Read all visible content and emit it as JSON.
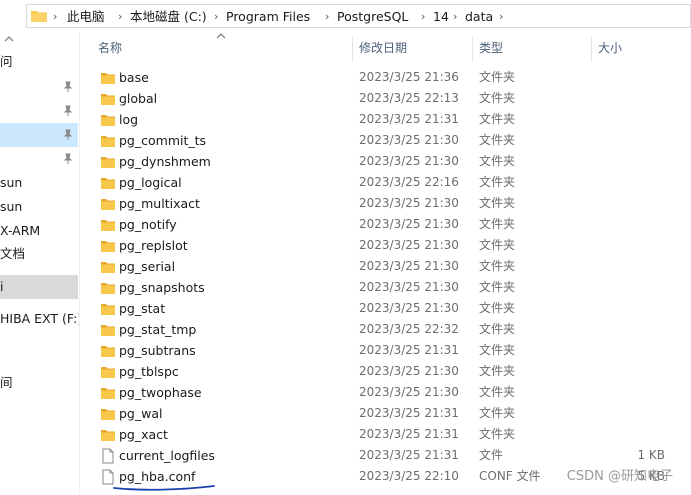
{
  "breadcrumb": {
    "items": [
      "此电脑",
      "本地磁盘 (C:)",
      "Program Files",
      "PostgreSQL",
      "14",
      "data"
    ]
  },
  "nav": {
    "items": [
      {
        "label": "问"
      },
      {
        "label": ""
      },
      {
        "label": ""
      },
      {
        "label": ""
      },
      {
        "label": ""
      },
      {
        "label": "sun"
      },
      {
        "label": "sun"
      },
      {
        "label": "X-ARM"
      },
      {
        "label": "文档"
      },
      {
        "label": "i"
      },
      {
        "label": "HIBA EXT (F:)"
      },
      {
        "label": "间"
      }
    ]
  },
  "columns": {
    "name": "名称",
    "modified": "修改日期",
    "type": "类型",
    "size": "大小"
  },
  "files": [
    {
      "name": "base",
      "modified": "2023/3/25 21:36",
      "type": "文件夹",
      "size": "",
      "kind": "folder"
    },
    {
      "name": "global",
      "modified": "2023/3/25 22:13",
      "type": "文件夹",
      "size": "",
      "kind": "folder"
    },
    {
      "name": "log",
      "modified": "2023/3/25 21:31",
      "type": "文件夹",
      "size": "",
      "kind": "folder"
    },
    {
      "name": "pg_commit_ts",
      "modified": "2023/3/25 21:30",
      "type": "文件夹",
      "size": "",
      "kind": "folder"
    },
    {
      "name": "pg_dynshmem",
      "modified": "2023/3/25 21:30",
      "type": "文件夹",
      "size": "",
      "kind": "folder"
    },
    {
      "name": "pg_logical",
      "modified": "2023/3/25 22:16",
      "type": "文件夹",
      "size": "",
      "kind": "folder"
    },
    {
      "name": "pg_multixact",
      "modified": "2023/3/25 21:30",
      "type": "文件夹",
      "size": "",
      "kind": "folder"
    },
    {
      "name": "pg_notify",
      "modified": "2023/3/25 21:30",
      "type": "文件夹",
      "size": "",
      "kind": "folder"
    },
    {
      "name": "pg_replslot",
      "modified": "2023/3/25 21:30",
      "type": "文件夹",
      "size": "",
      "kind": "folder"
    },
    {
      "name": "pg_serial",
      "modified": "2023/3/25 21:30",
      "type": "文件夹",
      "size": "",
      "kind": "folder"
    },
    {
      "name": "pg_snapshots",
      "modified": "2023/3/25 21:30",
      "type": "文件夹",
      "size": "",
      "kind": "folder"
    },
    {
      "name": "pg_stat",
      "modified": "2023/3/25 21:30",
      "type": "文件夹",
      "size": "",
      "kind": "folder"
    },
    {
      "name": "pg_stat_tmp",
      "modified": "2023/3/25 22:32",
      "type": "文件夹",
      "size": "",
      "kind": "folder"
    },
    {
      "name": "pg_subtrans",
      "modified": "2023/3/25 21:31",
      "type": "文件夹",
      "size": "",
      "kind": "folder"
    },
    {
      "name": "pg_tblspc",
      "modified": "2023/3/25 21:30",
      "type": "文件夹",
      "size": "",
      "kind": "folder"
    },
    {
      "name": "pg_twophase",
      "modified": "2023/3/25 21:30",
      "type": "文件夹",
      "size": "",
      "kind": "folder"
    },
    {
      "name": "pg_wal",
      "modified": "2023/3/25 21:31",
      "type": "文件夹",
      "size": "",
      "kind": "folder"
    },
    {
      "name": "pg_xact",
      "modified": "2023/3/25 21:31",
      "type": "文件夹",
      "size": "",
      "kind": "folder"
    },
    {
      "name": "current_logfiles",
      "modified": "2023/3/25 21:31",
      "type": "文件",
      "size": "1 KB",
      "kind": "file"
    },
    {
      "name": "pg_hba.conf",
      "modified": "2023/3/25 22:10",
      "type": "CONF 文件",
      "size": "5 KB",
      "kind": "file"
    }
  ],
  "watermark": "CSDN @研知电子",
  "colors": {
    "folder": "#f8c84a",
    "folder_dark": "#e6a92c",
    "selection": "#cce8ff",
    "header_text": "#4c607a",
    "annotation": "#1b3fae"
  }
}
